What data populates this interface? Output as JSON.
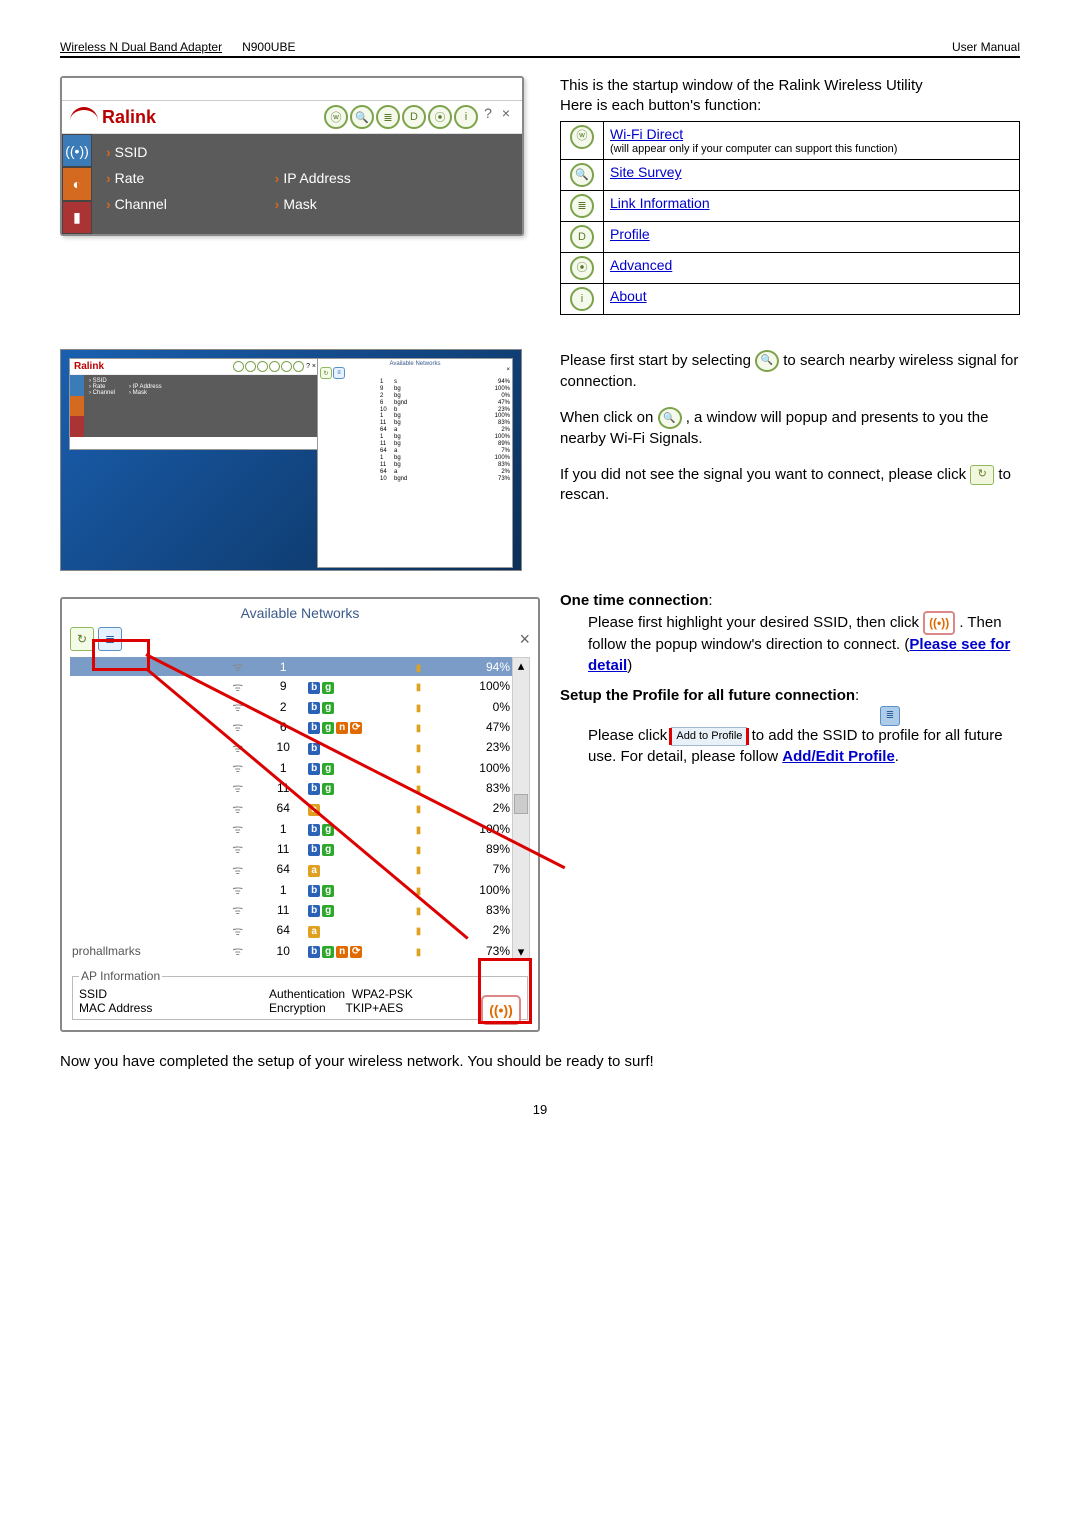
{
  "header": {
    "product_link": "Wireless N Dual Band Adapter",
    "model": "N900UBE",
    "right": "User Manual"
  },
  "ralink": {
    "brand": "Ralink",
    "fields": {
      "ssid": "SSID",
      "rate": "Rate",
      "channel": "Channel",
      "ip": "IP Address",
      "mask": "Mask"
    }
  },
  "intro": {
    "line1": "This is the startup window of the Ralink Wireless Utility",
    "line2": "Here is each button's function:"
  },
  "buttons_table": [
    {
      "icon": "ⓦ",
      "icon_name": "wifi-direct-icon",
      "label": "Wi-Fi Direct",
      "sub": "(will appear only if your computer can support this function)"
    },
    {
      "icon": "🔍",
      "icon_name": "site-survey-icon",
      "label": "Site Survey"
    },
    {
      "icon": "≣",
      "icon_name": "link-info-icon",
      "label": "Link Information"
    },
    {
      "icon": "D",
      "icon_name": "profile-icon",
      "label": "Profile"
    },
    {
      "icon": "⦿",
      "icon_name": "advanced-icon",
      "label": "Advanced"
    },
    {
      "icon": "i",
      "icon_name": "about-icon",
      "label": "About"
    }
  ],
  "para2": {
    "p1a": "Please first start by selecting ",
    "p1b": " to search nearby wireless signal for connection.",
    "p2a": "When click on ",
    "p2b": ", a window will popup and presents to you the nearby Wi-Fi Signals.",
    "p3a": "If you did not see the signal you want to connect, please click ",
    "p3b": " to rescan."
  },
  "onetime": {
    "title": "One time connection",
    "colon": ":",
    "body_a": "Please first highlight your desired SSID, then click ",
    "body_b": ". Then follow the popup window's direction to connect. (",
    "link": "Please see for detail",
    "body_c": ")"
  },
  "setup": {
    "title": "Setup the Profile for all future connection",
    "colon": ":",
    "body_a": "Please click ",
    "add_label": "Add to Profile",
    "body_b": " to add the SSID to profile for all future use. For detail, please follow ",
    "link": "Add/Edit Profile",
    "body_c": "."
  },
  "available": {
    "title": "Available Networks",
    "networks": [
      {
        "ssid": "",
        "ch": "1",
        "flags": [
          "s"
        ],
        "sig": "94%",
        "hdr": true
      },
      {
        "ssid": "",
        "ch": "9",
        "flags": [
          "b",
          "g"
        ],
        "sig": "100%"
      },
      {
        "ssid": "",
        "ch": "2",
        "flags": [
          "b",
          "g"
        ],
        "sig": "0%"
      },
      {
        "ssid": "",
        "ch": "6",
        "flags": [
          "b",
          "g",
          "n",
          "d"
        ],
        "sig": "47%"
      },
      {
        "ssid": "",
        "ch": "10",
        "flags": [
          "b"
        ],
        "sig": "23%"
      },
      {
        "ssid": "",
        "ch": "1",
        "flags": [
          "b",
          "g"
        ],
        "sig": "100%"
      },
      {
        "ssid": "",
        "ch": "11",
        "flags": [
          "b",
          "g"
        ],
        "sig": "83%"
      },
      {
        "ssid": "",
        "ch": "64",
        "flags": [
          "a"
        ],
        "sig": "2%"
      },
      {
        "ssid": "",
        "ch": "1",
        "flags": [
          "b",
          "g"
        ],
        "sig": "100%"
      },
      {
        "ssid": "",
        "ch": "11",
        "flags": [
          "b",
          "g"
        ],
        "sig": "89%"
      },
      {
        "ssid": "",
        "ch": "64",
        "flags": [
          "a"
        ],
        "sig": "7%"
      },
      {
        "ssid": "",
        "ch": "1",
        "flags": [
          "b",
          "g"
        ],
        "sig": "100%"
      },
      {
        "ssid": "",
        "ch": "11",
        "flags": [
          "b",
          "g"
        ],
        "sig": "83%"
      },
      {
        "ssid": "",
        "ch": "64",
        "flags": [
          "a"
        ],
        "sig": "2%"
      },
      {
        "ssid": "prohallmarks",
        "ch": "10",
        "flags": [
          "b",
          "g",
          "n",
          "d"
        ],
        "sig": "73%"
      }
    ],
    "ap_info": {
      "legend": "AP Information",
      "ssid_label": "SSID",
      "auth_label": "Authentication",
      "auth_val": "WPA2-PSK",
      "mac_label": "MAC Address",
      "mac_val": "",
      "enc_label": "Encryption",
      "enc_val": "TKIP+AES"
    }
  },
  "closing": "Now you have completed the setup of your wireless network. You should be ready to surf!",
  "page": "19"
}
